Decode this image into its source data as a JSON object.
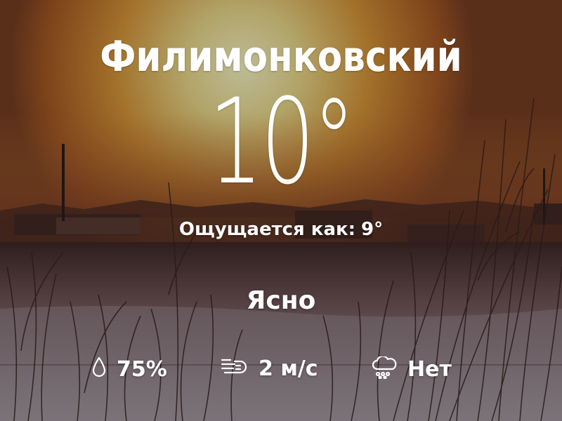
{
  "location": {
    "name": "Филимонковский"
  },
  "current": {
    "temperature": "10°",
    "feels_like_label": "Ощущается как:",
    "feels_like_value": "9°",
    "condition": "Ясно"
  },
  "stats": {
    "humidity": {
      "icon": "droplet-icon",
      "value": "75%"
    },
    "wind": {
      "icon": "wind-icon",
      "value": "2 м/с"
    },
    "precipitation": {
      "icon": "cloud-rain-icon",
      "value": "Нет"
    }
  },
  "background": {
    "description_colors": {
      "sun": "#e9d89a",
      "sky_mid": "#c9852c",
      "sky_low": "#8c4a1f",
      "snow": "#9b8d93"
    }
  }
}
